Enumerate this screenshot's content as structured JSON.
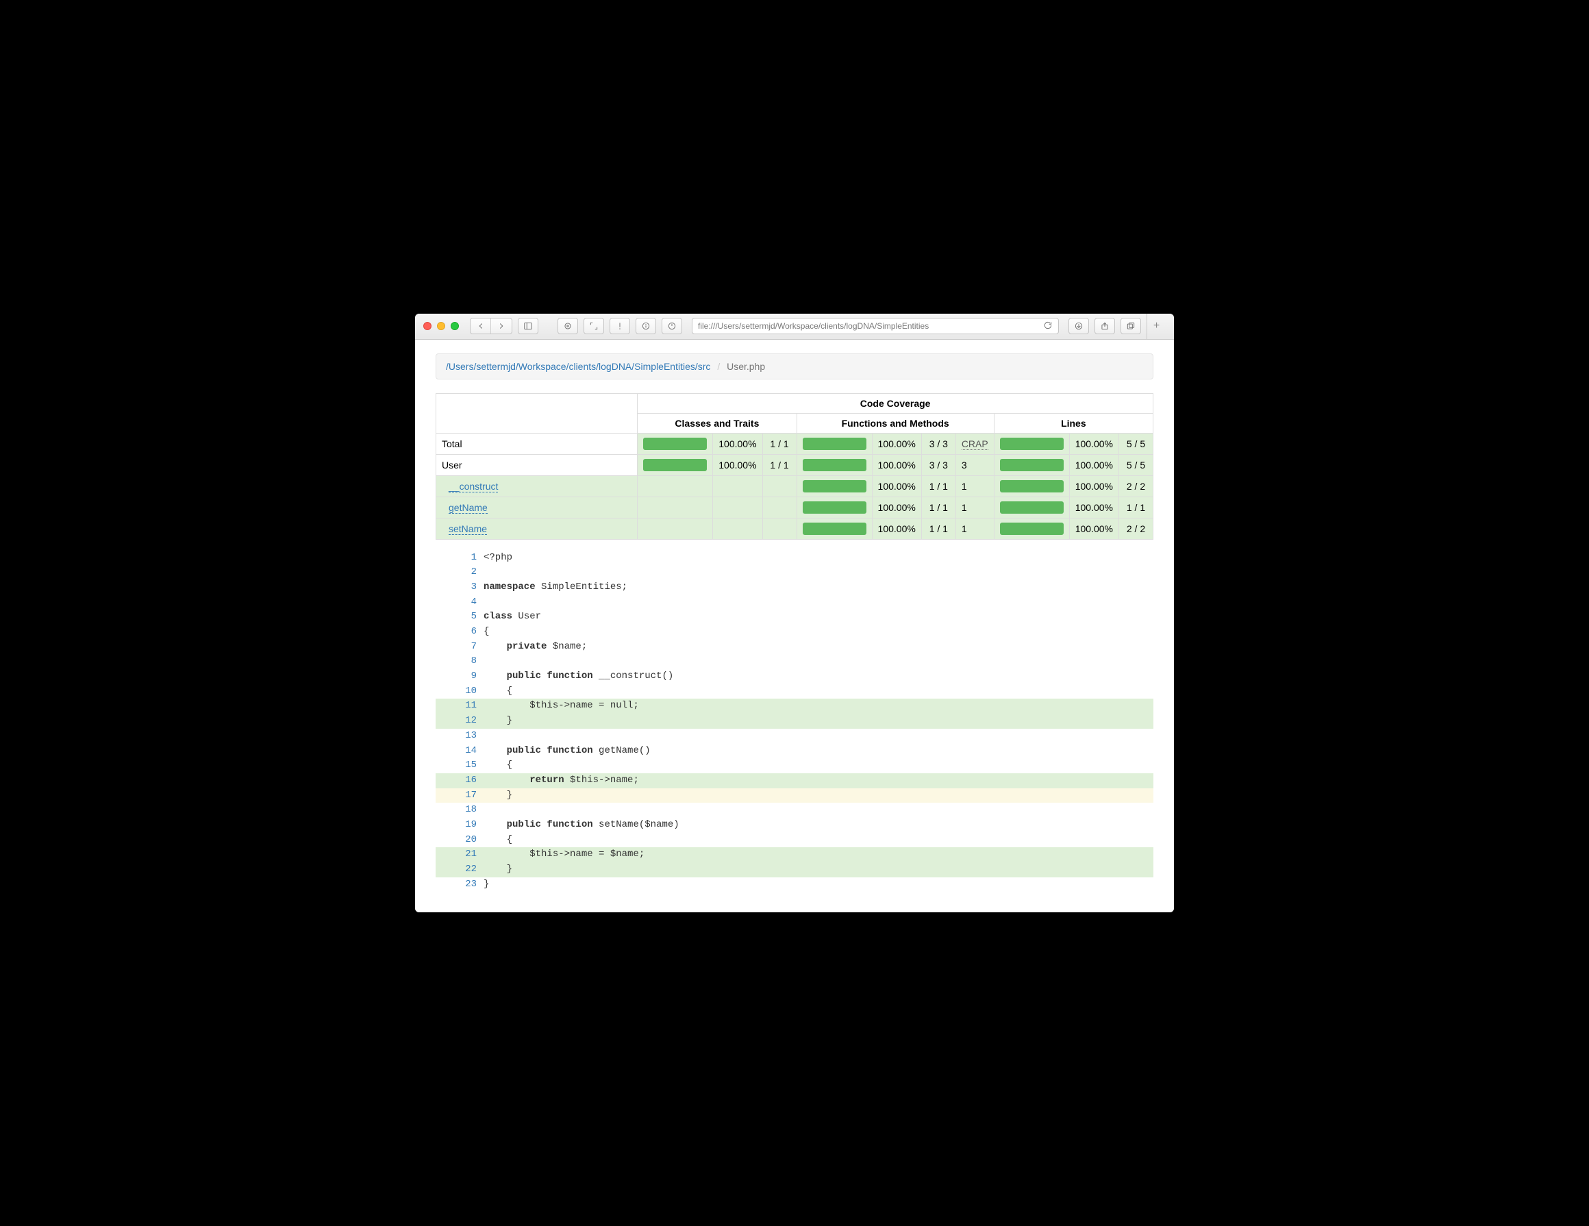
{
  "browser": {
    "url": "file:///Users/settermjd/Workspace/clients/logDNA/SimpleEntities"
  },
  "breadcrumb": {
    "path_link": "/Users/settermjd/Workspace/clients/logDNA/SimpleEntities/src",
    "current": "User.php"
  },
  "table": {
    "title": "Code Coverage",
    "group_headers": [
      "Classes and Traits",
      "Functions and Methods",
      "Lines"
    ],
    "crap_label": "CRAP",
    "rows": [
      {
        "kind": "total",
        "label": "Total",
        "classes": {
          "pct": "100.00%",
          "ratio": "1 / 1"
        },
        "methods": {
          "pct": "100.00%",
          "ratio": "3 / 3",
          "crap": ""
        },
        "lines": {
          "pct": "100.00%",
          "ratio": "5 / 5"
        }
      },
      {
        "kind": "class",
        "label": "User",
        "classes": {
          "pct": "100.00%",
          "ratio": "1 / 1"
        },
        "methods": {
          "pct": "100.00%",
          "ratio": "3 / 3",
          "crap": "3"
        },
        "lines": {
          "pct": "100.00%",
          "ratio": "5 / 5"
        }
      },
      {
        "kind": "method",
        "label": "__construct",
        "methods": {
          "pct": "100.00%",
          "ratio": "1 / 1",
          "crap": "1"
        },
        "lines": {
          "pct": "100.00%",
          "ratio": "2 / 2"
        }
      },
      {
        "kind": "method",
        "label": "getName",
        "methods": {
          "pct": "100.00%",
          "ratio": "1 / 1",
          "crap": "1"
        },
        "lines": {
          "pct": "100.00%",
          "ratio": "1 / 1"
        }
      },
      {
        "kind": "method",
        "label": "setName",
        "methods": {
          "pct": "100.00%",
          "ratio": "1 / 1",
          "crap": "1"
        },
        "lines": {
          "pct": "100.00%",
          "ratio": "2 / 2"
        }
      }
    ]
  },
  "source": {
    "lines": [
      {
        "n": 1,
        "status": "",
        "tokens": [
          {
            "t": "<?php",
            "c": "nm"
          }
        ]
      },
      {
        "n": 2,
        "status": "",
        "tokens": []
      },
      {
        "n": 3,
        "status": "",
        "tokens": [
          {
            "t": "namespace",
            "c": "kw"
          },
          {
            "t": " SimpleEntities;",
            "c": "nm"
          }
        ]
      },
      {
        "n": 4,
        "status": "",
        "tokens": []
      },
      {
        "n": 5,
        "status": "",
        "tokens": [
          {
            "t": "class",
            "c": "kw"
          },
          {
            "t": " User",
            "c": "nm"
          }
        ]
      },
      {
        "n": 6,
        "status": "",
        "tokens": [
          {
            "t": "{",
            "c": "nm"
          }
        ]
      },
      {
        "n": 7,
        "status": "",
        "tokens": [
          {
            "t": "    ",
            "c": "nm"
          },
          {
            "t": "private",
            "c": "kw"
          },
          {
            "t": " $name;",
            "c": "nm"
          }
        ]
      },
      {
        "n": 8,
        "status": "",
        "tokens": []
      },
      {
        "n": 9,
        "status": "",
        "tokens": [
          {
            "t": "    ",
            "c": "nm"
          },
          {
            "t": "public function",
            "c": "kw"
          },
          {
            "t": " __construct()",
            "c": "nm"
          }
        ]
      },
      {
        "n": 10,
        "status": "",
        "tokens": [
          {
            "t": "    {",
            "c": "nm"
          }
        ]
      },
      {
        "n": 11,
        "status": "covered",
        "tokens": [
          {
            "t": "        $this->name = null;",
            "c": "nm"
          }
        ]
      },
      {
        "n": 12,
        "status": "covered",
        "tokens": [
          {
            "t": "    }",
            "c": "nm"
          }
        ]
      },
      {
        "n": 13,
        "status": "",
        "tokens": []
      },
      {
        "n": 14,
        "status": "",
        "tokens": [
          {
            "t": "    ",
            "c": "nm"
          },
          {
            "t": "public function",
            "c": "kw"
          },
          {
            "t": " getName()",
            "c": "nm"
          }
        ]
      },
      {
        "n": 15,
        "status": "",
        "tokens": [
          {
            "t": "    {",
            "c": "nm"
          }
        ]
      },
      {
        "n": 16,
        "status": "covered",
        "tokens": [
          {
            "t": "        ",
            "c": "nm"
          },
          {
            "t": "return",
            "c": "kw"
          },
          {
            "t": " $this->name;",
            "c": "nm"
          }
        ]
      },
      {
        "n": 17,
        "status": "warn",
        "tokens": [
          {
            "t": "    }",
            "c": "nm"
          }
        ]
      },
      {
        "n": 18,
        "status": "",
        "tokens": []
      },
      {
        "n": 19,
        "status": "",
        "tokens": [
          {
            "t": "    ",
            "c": "nm"
          },
          {
            "t": "public function",
            "c": "kw"
          },
          {
            "t": " setName($name)",
            "c": "nm"
          }
        ]
      },
      {
        "n": 20,
        "status": "",
        "tokens": [
          {
            "t": "    {",
            "c": "nm"
          }
        ]
      },
      {
        "n": 21,
        "status": "covered",
        "tokens": [
          {
            "t": "        $this->name = $name;",
            "c": "nm"
          }
        ]
      },
      {
        "n": 22,
        "status": "covered",
        "tokens": [
          {
            "t": "    }",
            "c": "nm"
          }
        ]
      },
      {
        "n": 23,
        "status": "",
        "tokens": [
          {
            "t": "}",
            "c": "nm"
          }
        ]
      }
    ]
  }
}
